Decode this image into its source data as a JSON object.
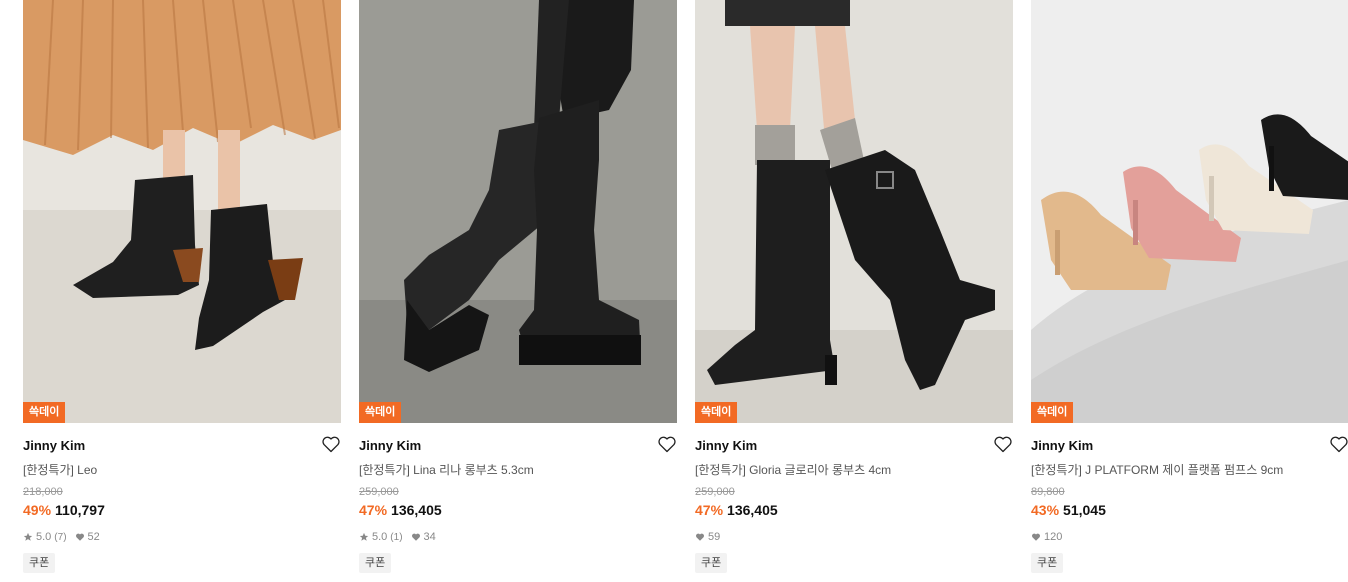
{
  "products": [
    {
      "badge": "쓱데이",
      "brand": "Jinny Kim",
      "title": "[한정특가] Leo",
      "original_price": "218,000",
      "discount": "49%",
      "price": "110,797",
      "rating": "5.0",
      "review_count": "(7)",
      "likes": "52",
      "coupon": "쿠폰",
      "image_desc": "black ankle boots with tortoiseshell heel"
    },
    {
      "badge": "쓱데이",
      "brand": "Jinny Kim",
      "title": "[한정특가] Lina 리나 롱부츠 5.3cm",
      "original_price": "259,000",
      "discount": "47%",
      "price": "136,405",
      "rating": "5.0",
      "review_count": "(1)",
      "likes": "34",
      "coupon": "쿠폰",
      "image_desc": "black knee-high lug sole boots"
    },
    {
      "badge": "쓱데이",
      "brand": "Jinny Kim",
      "title": "[한정특가] Gloria 글로리아 롱부츠 4cm",
      "original_price": "259,000",
      "discount": "47%",
      "price": "136,405",
      "likes": "59",
      "coupon": "쿠폰",
      "image_desc": "black riding boots with buckle"
    },
    {
      "badge": "쓱데이",
      "brand": "Jinny Kim",
      "title": "[한정특가] J PLATFORM 제이 플랫폼 펌프스 9cm",
      "original_price": "89,800",
      "discount": "43%",
      "price": "51,045",
      "likes": "120",
      "coupon": "쿠폰",
      "image_desc": "row of platform pumps in beige, pink, ivory, black"
    }
  ],
  "colors": {
    "accent": "#f26a24",
    "muted": "#999999"
  },
  "icons": {
    "wishlist": "heart-outline-icon",
    "rating": "star-icon",
    "likes": "heart-filled-icon"
  }
}
